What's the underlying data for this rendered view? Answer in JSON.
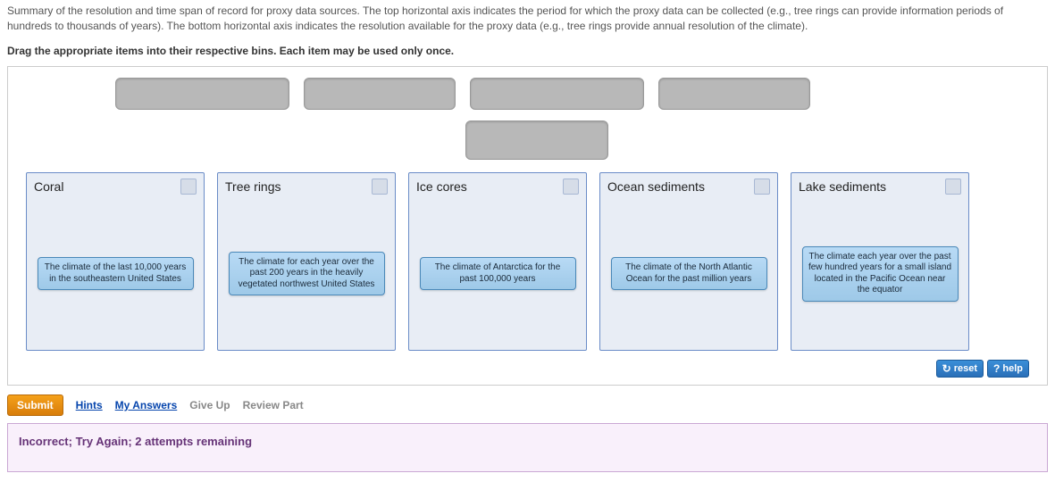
{
  "intro": "Summary of the resolution and time span of record for proxy data sources. The top horizontal axis indicates the period for which the proxy data can be collected (e.g., tree rings can provide information periods of hundreds to thousands of years). The bottom horizontal axis indicates the resolution available for the proxy data (e.g., tree rings provide annual resolution of the climate).",
  "instructions": "Drag the appropriate items into their respective bins. Each item may be used only once.",
  "bins": [
    {
      "title": "Coral",
      "answer": "The climate of the last 10,000 years in the southeastern United States"
    },
    {
      "title": "Tree rings",
      "answer": "The climate for each year over the past 200 years in the heavily vegetated northwest United States"
    },
    {
      "title": "Ice cores",
      "answer": "The climate of Antarctica for the past 100,000 years"
    },
    {
      "title": "Ocean sediments",
      "answer": "The climate of the North Atlantic Ocean for the past million years"
    },
    {
      "title": "Lake sediments",
      "answer": "The climate each year over the past few hundred years for a small island located in the Pacific Ocean near the equator"
    }
  ],
  "controls": {
    "reset": "reset",
    "help": "help"
  },
  "footer": {
    "submit": "Submit",
    "hints": "Hints",
    "my_answers": "My Answers",
    "give_up": "Give Up",
    "review": "Review Part"
  },
  "feedback": "Incorrect; Try Again; 2 attempts remaining"
}
